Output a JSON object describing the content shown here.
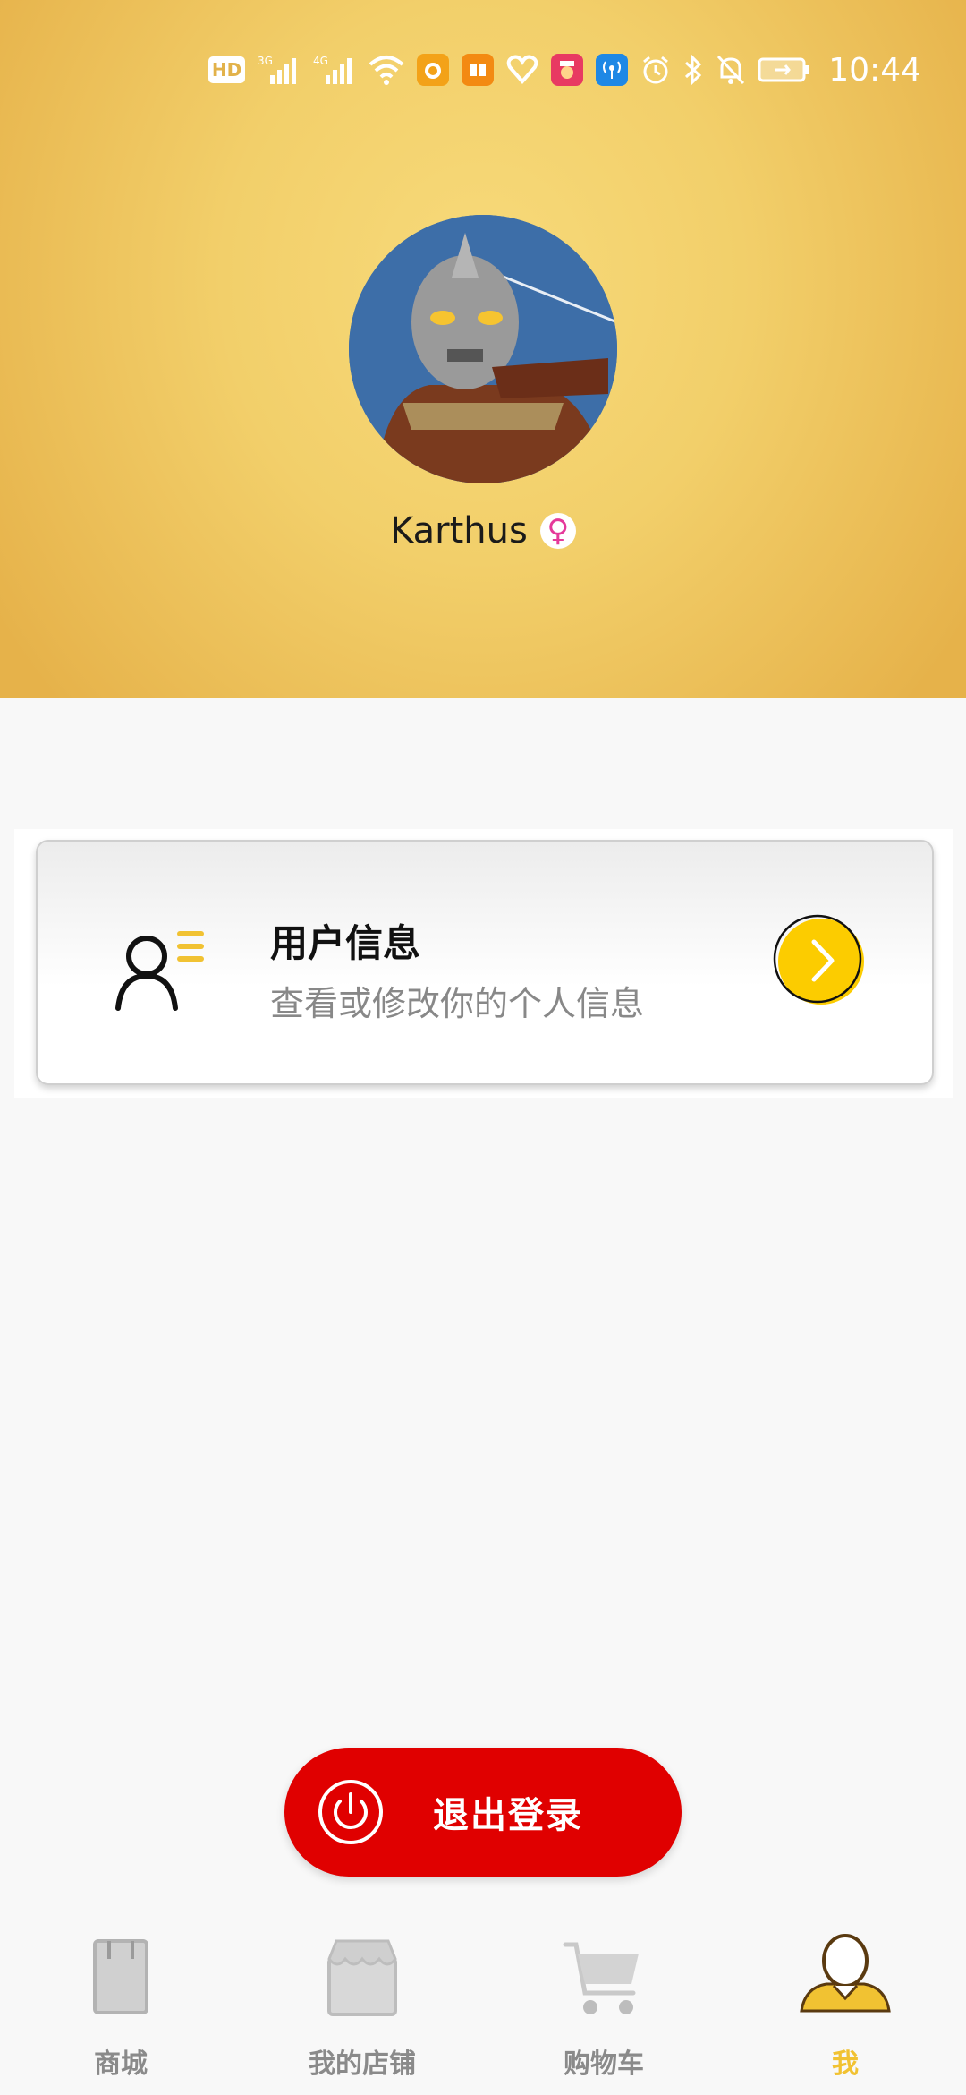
{
  "status_bar": {
    "time": "10:44",
    "icons": [
      "hd-icon",
      "signal-3g-icon",
      "signal-4g-icon",
      "wifi-icon",
      "app-notify-icon",
      "app-reader-icon",
      "app-heart-icon",
      "app-game-icon",
      "app-hotspot-icon",
      "alarm-icon",
      "bluetooth-icon",
      "mute-icon",
      "battery-icon"
    ],
    "hd_label": "HD",
    "net1": "3G",
    "net2": "4G"
  },
  "profile": {
    "username": "Karthus",
    "gender_symbol": "♀",
    "gender_color": "#e5399a"
  },
  "user_info_card": {
    "title": "用户信息",
    "subtitle": "查看或修改你的个人信息"
  },
  "logout": {
    "label": "退出登录",
    "color": "#e00000"
  },
  "tabbar": {
    "active_color": "#f1c232",
    "inactive_color": "#8a8a8a",
    "tabs": [
      {
        "label": "商城",
        "icon": "shop-bag-icon"
      },
      {
        "label": "我的店铺",
        "icon": "store-icon"
      },
      {
        "label": "购物车",
        "icon": "cart-icon"
      },
      {
        "label": "我",
        "icon": "person-icon"
      }
    ]
  }
}
